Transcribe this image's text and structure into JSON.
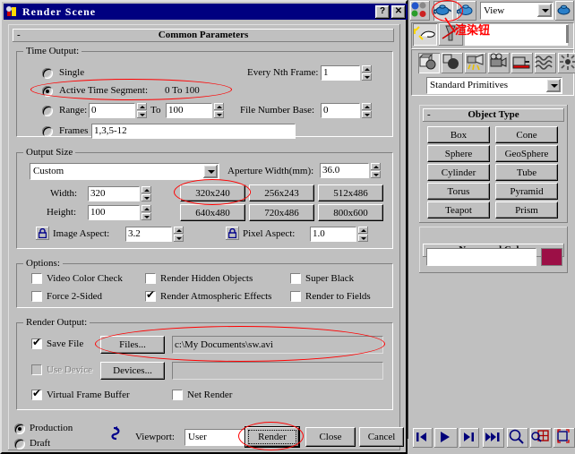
{
  "window": {
    "title": "Render Scene",
    "icon": "max-app-icon",
    "help_button": "?",
    "close_button": "✕"
  },
  "rollouts": {
    "common_parameters": {
      "minus": "-",
      "title": "Common Parameters"
    }
  },
  "time_output": {
    "group_label": "Time Output:",
    "selected": "active_time_segment",
    "options": [
      {
        "id": "single",
        "label": "Single"
      },
      {
        "id": "active_time_segment",
        "label": "Active Time Segment:",
        "value": "0 To 100"
      },
      {
        "id": "range",
        "label": "Range:",
        "from": "0",
        "to_label": "To",
        "to": "100"
      },
      {
        "id": "frames",
        "label": "Frames",
        "value": "1,3,5-12"
      }
    ],
    "every_nth_frame_label": "Every Nth Frame:",
    "every_nth_frame": "1",
    "file_number_base_label": "File Number Base:",
    "file_number_base": "0"
  },
  "output_size": {
    "group_label": "Output Size",
    "preset": "Custom",
    "aperture_label": "Aperture Width(mm):",
    "aperture_width": "36.0",
    "width_label": "Width:",
    "width": "320",
    "height_label": "Height:",
    "height": "100",
    "image_aspect_label": "Image Aspect:",
    "image_aspect": "3.2",
    "pixel_aspect_label": "Pixel Aspect:",
    "pixel_aspect": "1.0",
    "presets": [
      "320x240",
      "256x243",
      "512x486",
      "640x480",
      "720x486",
      "800x600"
    ],
    "highlighted_preset": "320x240"
  },
  "options": {
    "group_label": "Options:",
    "items": [
      {
        "label": "Video Color Check",
        "checked": false
      },
      {
        "label": "Render Hidden Objects",
        "checked": false
      },
      {
        "label": "Super Black",
        "checked": false
      },
      {
        "label": "Force 2-Sided",
        "checked": false
      },
      {
        "label": "Render Atmospheric Effects",
        "checked": true
      },
      {
        "label": "Render to Fields",
        "checked": false
      }
    ]
  },
  "render_output": {
    "group_label": "Render Output:",
    "save_file_label": "Save File",
    "save_file_checked": true,
    "files_button": "Files...",
    "file_path": "c:\\My Documents\\sw.avi",
    "use_device_label": "Use Device",
    "use_device_checked": false,
    "devices_button": "Devices...",
    "device_path": "",
    "virtual_frame_buffer_label": "Virtual Frame Buffer",
    "virtual_frame_buffer_checked": true,
    "net_render_label": "Net Render",
    "net_render_checked": false
  },
  "footer": {
    "production_label": "Production",
    "draft_label": "Draft",
    "mode_selected": "production",
    "preset_icon": "preset-curve-icon",
    "viewport_label": "Viewport:",
    "viewport_value": "User",
    "render_button": "Render",
    "close_button": "Close",
    "cancel_button": "Cancel"
  },
  "command_panel": {
    "toolbar": {
      "material_editor_icon": "material-editor-icon",
      "render_scene_icon": "render-scene-icon",
      "quick_render_icon": "quick-render-icon",
      "view_dropdown": "View",
      "render_type_icon": "render-type-icon"
    },
    "tabs": [
      {
        "id": "create",
        "icon": "create-arrow-icon",
        "active": false
      },
      {
        "id": "modify",
        "icon": "modify-tube-icon",
        "active": true
      }
    ],
    "category_icons": [
      "geometry-icon",
      "shapes-icon",
      "lights-icon",
      "cameras-icon",
      "helpers-icon",
      "space-warps-icon",
      "systems-icon"
    ],
    "category_selected": "geometry-icon",
    "subcategory": "Standard Primitives",
    "object_type": {
      "minus": "-",
      "title": "Object Type",
      "buttons": [
        "Box",
        "Cone",
        "Sphere",
        "GeoSphere",
        "Cylinder",
        "Tube",
        "Torus",
        "Pyramid",
        "Teapot",
        "Prism"
      ]
    },
    "name_and_color": {
      "minus": "-",
      "title": "Name and Color",
      "name_value": "",
      "color_swatch": "#9c0f46"
    },
    "playback": [
      "prev-frame-icon",
      "play-animation-icon",
      "next-frame-icon",
      "end-frame-icon",
      "zoom-icon",
      "zoom-all-icon",
      "zoom-extents-icon",
      "zoom-extents-all-icon"
    ]
  },
  "annotations": {
    "render_button_note": "渲染钮",
    "note_color": "#ff0000",
    "highlighted": [
      "active-time-segment-row",
      "preset-320x240",
      "file-path-row",
      "render-button",
      "quick-render-toolbar-icon"
    ]
  }
}
